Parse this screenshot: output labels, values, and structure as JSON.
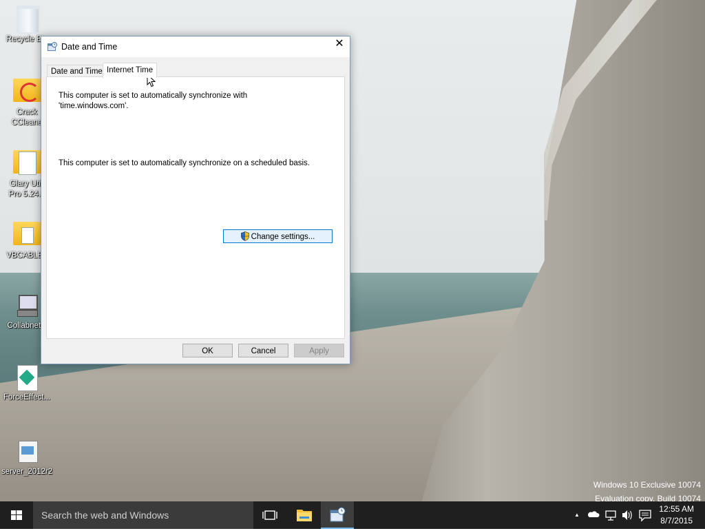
{
  "desktop": {
    "icons": [
      {
        "label": "Recycle Bin"
      },
      {
        "label": "Crack\nCCleane"
      },
      {
        "label": "Glary Utili\nPro 5.24.0"
      },
      {
        "label": "VBCABLE_"
      },
      {
        "label": "CollabnetU"
      },
      {
        "label": "ForceEffect..."
      },
      {
        "label": "server_2012r2"
      }
    ],
    "watermark": {
      "line1": "Windows 10 Exclusive 10074",
      "line2": "Evaluation copy. Build 10074"
    }
  },
  "dialog": {
    "title": "Date and Time",
    "close_glyph": "✕",
    "tabs": [
      {
        "label": "Date and Time",
        "active": false
      },
      {
        "label": "Internet Time",
        "active": true
      }
    ],
    "panel": {
      "sync_line1": "This computer is set to automatically synchronize with",
      "sync_line2": "'time.windows.com'.",
      "schedule_text": "This computer is set to automatically synchronize on a scheduled basis.",
      "change_settings_label": "Change settings..."
    },
    "buttons": {
      "ok": "OK",
      "cancel": "Cancel",
      "apply": "Apply"
    }
  },
  "taskbar": {
    "search_placeholder": "Search the web and Windows",
    "clock_time": "12:55 AM",
    "clock_date": "8/7/2015",
    "tray_chevron": "▲"
  },
  "colors": {
    "accent": "#0078d7",
    "taskbar": "#1f1f1f",
    "search_box": "#3b3b3b"
  }
}
